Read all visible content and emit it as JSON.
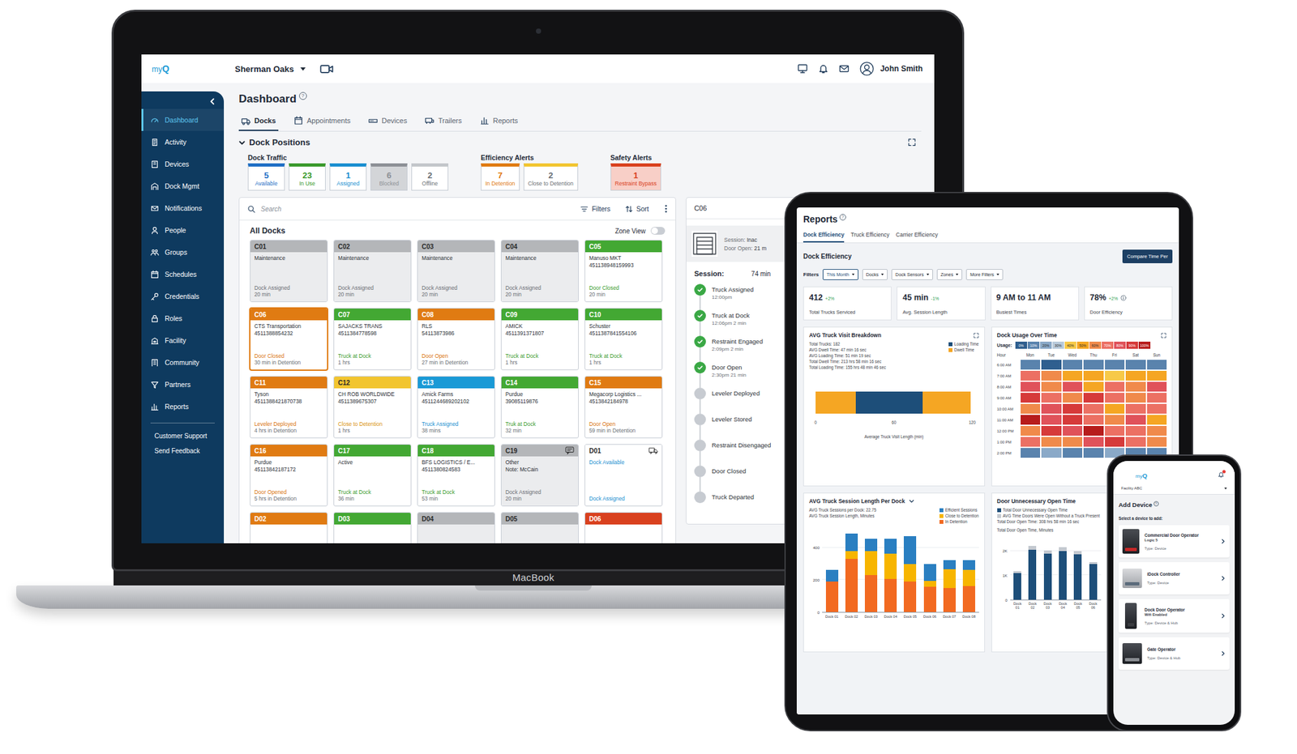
{
  "laptop": {
    "brand": "MacBook",
    "header": {
      "logo_prefix": "my",
      "logo_suffix": "Q",
      "facility": "Sherman Oaks",
      "user": "John Smith"
    },
    "sidebar": {
      "items": [
        {
          "label": "Dashboard",
          "selected": true
        },
        {
          "label": "Activity",
          "selected": false
        },
        {
          "label": "Devices",
          "selected": false
        },
        {
          "label": "Dock Mgmt",
          "selected": false
        },
        {
          "label": "Notifications",
          "selected": false
        },
        {
          "label": "People",
          "selected": false
        },
        {
          "label": "Groups",
          "selected": false
        },
        {
          "label": "Schedules",
          "selected": false
        },
        {
          "label": "Credentials",
          "selected": false
        },
        {
          "label": "Roles",
          "selected": false
        },
        {
          "label": "Facility",
          "selected": false
        },
        {
          "label": "Community",
          "selected": false
        },
        {
          "label": "Partners",
          "selected": false
        },
        {
          "label": "Reports",
          "selected": false
        }
      ],
      "footer": [
        "Customer Support",
        "Send Feedback"
      ]
    },
    "page": {
      "title": "Dashboard",
      "help": "?"
    },
    "tabs": [
      {
        "label": "Docks",
        "selected": true
      },
      {
        "label": "Appointments",
        "selected": false
      },
      {
        "label": "Devices",
        "selected": false
      },
      {
        "label": "Trailers",
        "selected": false
      },
      {
        "label": "Reports",
        "selected": false
      }
    ],
    "section": {
      "title": "Dock Positions",
      "expanded": true
    },
    "summary": [
      {
        "title": "Dock Traffic",
        "items": [
          {
            "value": "5",
            "label": "Available",
            "color": "#1f6fc5",
            "fill": "#ffffff"
          },
          {
            "value": "23",
            "label": "In Use",
            "color": "#3a9a2c",
            "fill": "#ffffff"
          },
          {
            "value": "1",
            "label": "Assigned",
            "color": "#1a8fd0",
            "fill": "#ffffff"
          },
          {
            "value": "6",
            "label": "Blocked",
            "color": "#8d9096",
            "fill": "#d3d5d8"
          },
          {
            "value": "2",
            "label": "Offline",
            "color": "#c3c6ca",
            "fill": "#ffffff"
          }
        ]
      },
      {
        "title": "Efficiency Alerts",
        "items": [
          {
            "value": "7",
            "label": "In Detention",
            "color": "#e07b12",
            "fill": "#ffffff"
          },
          {
            "value": "2",
            "label": "Close to Detention",
            "color": "#f2c530",
            "fill": "#ffffff"
          }
        ]
      },
      {
        "title": "Safety Alerts",
        "items": [
          {
            "value": "1",
            "label": "Restraint Bypass",
            "color": "#d9411e",
            "fill": "#f8cfc7"
          }
        ]
      }
    ],
    "toolbar": {
      "search_placeholder": "Search",
      "filters": "Filters",
      "sort": "Sort"
    },
    "docks_title": "All Docks",
    "zone_view": {
      "label": "Zone View",
      "on": false
    },
    "docks": [
      {
        "id": "C01",
        "color": "#b4b6b9",
        "kind": "standard",
        "selected": false,
        "disabled": true,
        "name": "Maintenance",
        "status": "Dock Assigned",
        "status_color": "#6b6f75",
        "time": "20 min"
      },
      {
        "id": "C02",
        "color": "#b4b6b9",
        "kind": "standard",
        "selected": false,
        "disabled": true,
        "name": "Maintenance",
        "status": "Dock Assigned",
        "status_color": "#6b6f75",
        "time": "20 min"
      },
      {
        "id": "C03",
        "color": "#b4b6b9",
        "kind": "standard",
        "selected": false,
        "disabled": true,
        "name": "Maintenance",
        "status": "Dock Assigned",
        "status_color": "#6b6f75",
        "time": "20 min"
      },
      {
        "id": "C04",
        "color": "#b4b6b9",
        "kind": "standard",
        "selected": false,
        "disabled": true,
        "name": "Maintenance",
        "status": "Dock Assigned",
        "status_color": "#6b6f75",
        "time": "20 min"
      },
      {
        "id": "C05",
        "color": "#43a833",
        "kind": "standard",
        "selected": false,
        "disabled": false,
        "name": "Manuso MKT",
        "number": "451138948159993",
        "status": "Door Closed",
        "status_color": "#3a9a2c",
        "time": "20 min"
      },
      {
        "id": "C06",
        "color": "#e07b12",
        "kind": "standard",
        "selected": true,
        "disabled": false,
        "name": "CTS Transportation",
        "number": "4511388854232",
        "status": "Door Closed",
        "status_color": "#d9730d",
        "time": "30 min in Detention"
      },
      {
        "id": "C07",
        "color": "#43a833",
        "kind": "standard",
        "selected": false,
        "disabled": false,
        "name": "SAJACKS TRANS",
        "number": "4511384778598",
        "status": "Truck at Dock",
        "status_color": "#3a9a2c",
        "time": "1 hrs"
      },
      {
        "id": "C08",
        "color": "#e07b12",
        "kind": "standard",
        "selected": false,
        "disabled": false,
        "name": "RLS",
        "number": "54113873986",
        "status": "Door Open",
        "status_color": "#d9730d",
        "time": "27 min in Detention"
      },
      {
        "id": "C09",
        "color": "#43a833",
        "kind": "standard",
        "selected": false,
        "disabled": false,
        "name": "AMICK",
        "number": "4511391371807",
        "status": "Truck at Dock",
        "status_color": "#3a9a2c",
        "time": "1 hrs"
      },
      {
        "id": "C10",
        "color": "#43a833",
        "kind": "standard",
        "selected": false,
        "disabled": false,
        "name": "Schuster",
        "number": "4511387841554106",
        "status": "Truck at Dock",
        "status_color": "#3a9a2c",
        "time": "1 hrs"
      },
      {
        "id": "C11",
        "color": "#e07b12",
        "kind": "standard",
        "selected": false,
        "disabled": false,
        "name": "Tyson",
        "number": "4511388421870738",
        "status": "Leveler Deployed",
        "status_color": "#d9730d",
        "time": "4 hrs in Detention"
      },
      {
        "id": "C12",
        "color": "#f2c530",
        "kind": "standard",
        "selected": false,
        "disabled": false,
        "name": "CH ROB WORLDWIDE",
        "number": "4511389675307",
        "status": "Close to Detention",
        "status_color": "#d9930d",
        "time": "1 hrs"
      },
      {
        "id": "C13",
        "color": "#1a9ad6",
        "kind": "standard",
        "selected": false,
        "disabled": false,
        "name": "Amick Farms",
        "number": "4511244689202102",
        "status": "Truck Assigned",
        "status_color": "#1a8fd0",
        "time": "38 mins"
      },
      {
        "id": "C14",
        "color": "#43a833",
        "kind": "standard",
        "selected": false,
        "disabled": false,
        "name": "Purdue",
        "number": "39085119876",
        "status": "Truk at Dock",
        "status_color": "#3a9a2c",
        "time": "32 min"
      },
      {
        "id": "C15",
        "color": "#e07b12",
        "kind": "standard",
        "selected": false,
        "disabled": false,
        "name": "Megacorp Logistics ...",
        "number": "4513842184978",
        "status": "Door Open",
        "status_color": "#d9730d",
        "time": "59 min in Detention"
      },
      {
        "id": "C16",
        "color": "#e07b12",
        "kind": "standard",
        "selected": false,
        "disabled": false,
        "name": "Purdue",
        "number": "45113842187172",
        "status": "Door Opened",
        "status_color": "#d9730d",
        "time": "5 hrs in Detention"
      },
      {
        "id": "C17",
        "color": "#43a833",
        "kind": "standard",
        "selected": false,
        "disabled": false,
        "name": "Active",
        "status": "Truck at Dock",
        "status_color": "#3a9a2c",
        "time": "36 min"
      },
      {
        "id": "C18",
        "color": "#43a833",
        "kind": "standard",
        "selected": false,
        "disabled": false,
        "name": "BFS LOGISTICS / E...",
        "number": "4511380824583",
        "status": "Truck at Dock",
        "status_color": "#3a9a2c",
        "time": "53 min"
      },
      {
        "id": "C19",
        "color": "#b4b6b9",
        "kind": "note",
        "selected": false,
        "disabled": true,
        "name": "Other",
        "number": "Note: McCain",
        "status": "Dock Assigned",
        "status_color": "#6b6f75",
        "time": "20 min"
      },
      {
        "id": "D01",
        "color": "#ffffff",
        "kind": "truck",
        "selected": false,
        "disabled": false,
        "name": "Dock Available",
        "name_color": "#1a8fd0",
        "status": "Dock Assigned",
        "status_color": "#1a8fd0"
      },
      {
        "id": "D02",
        "color": "#e07b12",
        "kind": "standard",
        "selected": false,
        "disabled": false
      },
      {
        "id": "D03",
        "color": "#43a833",
        "kind": "standard",
        "selected": false,
        "disabled": false
      },
      {
        "id": "D04",
        "color": "#b4b6b9",
        "kind": "standard",
        "selected": false,
        "disabled": true
      },
      {
        "id": "D05",
        "color": "#b4b6b9",
        "kind": "standard",
        "selected": false,
        "disabled": true
      },
      {
        "id": "D06",
        "color": "#d9411e",
        "kind": "standard",
        "selected": false,
        "disabled": false
      }
    ],
    "detail": {
      "title": "C06",
      "session_label": "Session:",
      "session_value": "Inac",
      "door_label": "Door Open:",
      "door_value": "21 m",
      "total_label": "Session:",
      "total_value": "74 min",
      "steps": [
        {
          "label": "Truck Assigned",
          "time": "12:00pm",
          "done": true
        },
        {
          "label": "Truck at Dock",
          "time": "12:06pm 2 min",
          "done": true
        },
        {
          "label": "Restraint Engaged",
          "time": "2:09pm 2 min",
          "done": true
        },
        {
          "label": "Door Open",
          "time": "2:30pm 21 min",
          "done": true
        },
        {
          "label": "Leveler Deployed",
          "done": false
        },
        {
          "label": "Leveler Stored",
          "done": false
        },
        {
          "label": "Restraint Disengaged",
          "done": false
        },
        {
          "label": "Door Closed",
          "done": false
        },
        {
          "label": "Truck Departed",
          "done": false
        }
      ]
    }
  },
  "tablet": {
    "title": "Reports",
    "help": "?",
    "tabs": [
      {
        "label": "Dock Efficiency",
        "selected": true
      },
      {
        "label": "Truck Efficiency",
        "selected": false
      },
      {
        "label": "Carrier Efficiency",
        "selected": false
      }
    ],
    "section_title": "Dock Efficiency",
    "compare_button": "Compare Time Per",
    "filters_label": "Filters",
    "filters": [
      {
        "label": "This Month",
        "selected": true
      },
      {
        "label": "Docks",
        "selected": false
      },
      {
        "label": "Dock Sensors",
        "selected": false
      },
      {
        "label": "Zones",
        "selected": false
      },
      {
        "label": "More Filters",
        "selected": false
      }
    ],
    "kpis": [
      {
        "value": "412",
        "delta": "+2%",
        "label": "Total Trucks Serviced",
        "info": false
      },
      {
        "value": "45 min",
        "delta": "-1%",
        "label": "Avg. Session Length",
        "info": false
      },
      {
        "value": "9 AM to 11 AM",
        "label": "Busiest Times",
        "info": false
      },
      {
        "value": "78%",
        "delta": "+2%",
        "label": "Door Efficiency",
        "info": true
      }
    ],
    "visit_chart": {
      "title": "AVG Truck Visit Breakdown",
      "legend": [
        {
          "label": "Loading Time",
          "color": "#1d4e79"
        },
        {
          "label": "Dwell Time",
          "color": "#f5a623"
        }
      ],
      "stats": [
        "Total Trucks: 182",
        "AVG Dwell Time: 47 min 16 sec",
        "AVG Loading Time: 51 min 19 sec",
        "Total Dwell Time: 213 hrs 58 min 16 sec",
        "Total Loading Time: 155 hrs 48 min 46 sec"
      ],
      "segments": [
        {
          "series": 1,
          "value": 31
        },
        {
          "series": 0,
          "value": 51
        },
        {
          "series": 1,
          "value": 37
        }
      ],
      "ticks": [
        "0",
        "60",
        "120"
      ],
      "axis_title": "Average Truck Visit Length (min)"
    },
    "usage_chart": {
      "title": "Dock Usage Over Time",
      "legend_label": "Usage:",
      "legend": [
        {
          "label": "0%",
          "color": "#2f5f8f"
        },
        {
          "label": "10%",
          "color": "#5a83ad"
        },
        {
          "label": "20%",
          "color": "#8aa9c8"
        },
        {
          "label": "30%",
          "color": "#b8cadb"
        },
        {
          "label": "40%",
          "color": "#f7c948"
        },
        {
          "label": "50%",
          "color": "#f5a623"
        },
        {
          "label": "60%",
          "color": "#f08a4b"
        },
        {
          "label": "70%",
          "color": "#ec7063"
        },
        {
          "label": "80%",
          "color": "#e0525a"
        },
        {
          "label": "90%",
          "color": "#d63a3a"
        },
        {
          "label": "100%",
          "color": "#b71c1c"
        }
      ],
      "columns": [
        "Hour",
        "Mon",
        "Tue",
        "Wed",
        "Thu",
        "Fri",
        "Sat",
        "Sun"
      ],
      "rows": [
        {
          "hour": "6:00 AM",
          "values": [
            0.1,
            0.0,
            0.1,
            0.1,
            0.1,
            0.1,
            0.1
          ]
        },
        {
          "hour": "7:00 AM",
          "values": [
            0.7,
            0.6,
            0.5,
            0.5,
            0.4,
            0.5,
            0.5
          ]
        },
        {
          "hour": "8:00 AM",
          "values": [
            0.8,
            0.6,
            0.8,
            0.5,
            0.7,
            0.6,
            0.8
          ]
        },
        {
          "hour": "9:00 AM",
          "values": [
            0.9,
            0.7,
            0.6,
            0.9,
            0.7,
            0.6,
            0.7
          ]
        },
        {
          "hour": "10:00 AM",
          "values": [
            0.6,
            0.8,
            0.9,
            0.7,
            0.5,
            0.7,
            0.7
          ]
        },
        {
          "hour": "11:00 AM",
          "values": [
            1.0,
            0.8,
            0.9,
            0.7,
            0.6,
            0.8,
            0.5
          ]
        },
        {
          "hour": "12:00 PM",
          "values": [
            0.6,
            0.9,
            0.8,
            1.0,
            0.7,
            0.7,
            0.6
          ]
        },
        {
          "hour": "1:00 PM",
          "values": [
            0.7,
            0.6,
            0.6,
            0.8,
            0.9,
            0.7,
            0.6
          ]
        },
        {
          "hour": "2:00 PM",
          "values": [
            0.1,
            0.2,
            0.1,
            0.1,
            0.2,
            0.1,
            0.1
          ]
        }
      ]
    },
    "session_chart": {
      "title": "AVG Truck Session Length Per Dock",
      "subtitles": [
        "AVG Truck Sessions per Dock: 22.75",
        "AVG Truck Session Length, Minutes"
      ],
      "series": [
        {
          "label": "Efficient Sessions",
          "color": "#2a7fc1",
          "values": [
            76,
            108,
            76,
            92,
            172,
            108,
            56,
            60
          ]
        },
        {
          "label": "Close to Detention",
          "color": "#f7b500",
          "values": [
            0,
            48,
            152,
            160,
            112,
            36,
            120,
            104
          ]
        },
        {
          "label": "In Detention",
          "color": "#f26a21",
          "values": [
            188,
            332,
            228,
            204,
            188,
            156,
            148,
            160
          ]
        }
      ],
      "ticks": [
        "400",
        "200",
        "0"
      ],
      "categories": [
        "Dock 01",
        "Dock 02",
        "Dock 03",
        "Dock 04",
        "Dock 05",
        "Dock 06",
        "Dock 07",
        "Dock 08"
      ]
    },
    "door_chart": {
      "title": "Door Unnecessary Open Time",
      "series": [
        {
          "label": "Total Door Unnecessary Open Time",
          "color": "#1d4e79",
          "values": [
            1100,
            2050,
            1900,
            2000,
            1850,
            1450
          ]
        },
        {
          "label": "AVG Time Doors Were Open Without a Truck Present",
          "color": "#c4c9d0",
          "values": [
            80,
            150,
            120,
            150,
            150,
            100
          ]
        }
      ],
      "stats": [
        "Total Door Open Time: 308 hrs 58 min 16 sec"
      ],
      "axis_title": "Total Door Open Time, Minutes",
      "ticks": [
        "2K",
        "1K",
        "0"
      ],
      "categories": [
        "Dock 01",
        "Dock 02",
        "Dock 03",
        "Dock 04",
        "Dock 05",
        "Dock 06"
      ]
    }
  },
  "phone": {
    "logo_prefix": "my",
    "logo_suffix": "Q",
    "unread": true,
    "facility": "Facility ABC",
    "title": "Add Device",
    "help": "?",
    "prompt": "Select a device to add:",
    "devices": [
      {
        "name": "Commercial Door Operator",
        "model": "Logic 5",
        "type": "Type: Device"
      },
      {
        "name": "iDock Controller",
        "type": "Type: Device"
      },
      {
        "name": "Dock Door Operator",
        "model": "Wifi Enabled",
        "type": "Type: Device & Hub"
      },
      {
        "name": "Gate Operator",
        "type": "Type: Device & Hub"
      }
    ]
  }
}
